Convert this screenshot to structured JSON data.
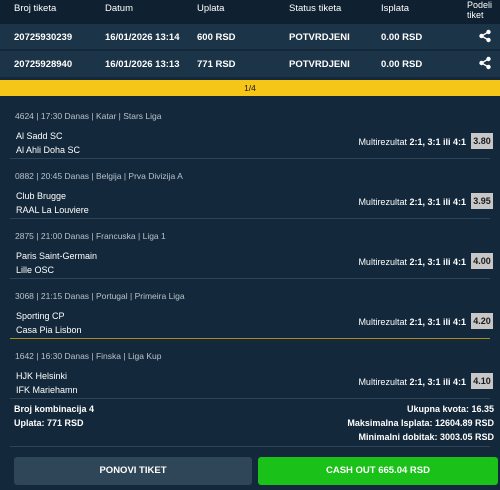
{
  "header": {
    "ticket_id": "Broj tiketa",
    "date": "Datum",
    "stake": "Uplata",
    "status": "Status tiketa",
    "payout": "Isplata",
    "share_line1": "Podeli",
    "share_line2": "tiket"
  },
  "tickets": [
    {
      "id": "20725930239",
      "date": "16/01/2026 13:14",
      "stake": "600 RSD",
      "status": "POTVRDJENI",
      "payout": "0.00 RSD"
    },
    {
      "id": "20725928940",
      "date": "16/01/2026 13:13",
      "stake": "771 RSD",
      "status": "POTVRDJENI",
      "payout": "0.00 RSD"
    }
  ],
  "pager": "1/4",
  "matches": [
    {
      "meta": "4624 | 17:30 Danas | Katar | Stars Liga",
      "home": "Al Sadd SC",
      "away": "Al Ahli Doha SC",
      "market": "Multirezultat",
      "pick": "2:1, 3:1 ili 4:1",
      "odd": "3.80"
    },
    {
      "meta": "0882 | 20:45 Danas | Belgija | Prva Divizija A",
      "home": "Club Brugge",
      "away": "RAAL La Louviere",
      "market": "Multirezultat",
      "pick": "2:1, 3:1 ili 4:1",
      "odd": "3.95"
    },
    {
      "meta": "2875 | 21:00 Danas | Francuska | Liga 1",
      "home": "Paris Saint-Germain",
      "away": "Lille OSC",
      "market": "Multirezultat",
      "pick": "2:1, 3:1 ili 4:1",
      "odd": "4.00"
    },
    {
      "meta": "3068 | 21:15 Danas | Portugal | Primeira Liga",
      "home": "Sporting CP",
      "away": "Casa Pia Lisbon",
      "market": "Multirezultat",
      "pick": "2:1, 3:1 ili 4:1",
      "odd": "4.20"
    },
    {
      "meta": "1642 | 16:30 Danas | Finska | Liga Kup",
      "home": "HJK Helsinki",
      "away": "IFK Mariehamn",
      "market": "Multirezultat",
      "pick": "2:1, 3:1 ili 4:1",
      "odd": "4.10"
    }
  ],
  "summary": {
    "combinations": "Broj kombinacija 4",
    "stake": "Uplata: 771 RSD",
    "total_odds": "Ukupna kvota: 16.35",
    "max_payout": "Maksimalna Isplata: 12604.89 RSD",
    "min_win": "Minimalni dobitak: 3003.05 RSD"
  },
  "buttons": {
    "repeat": "PONOVI TIKET",
    "cashout": "CASH OUT 665.04 RSD"
  },
  "colors": {
    "background": "#13283a",
    "pager": "#f5c518",
    "cashout": "#19c119",
    "odd_badge": "#c7c7c7"
  }
}
